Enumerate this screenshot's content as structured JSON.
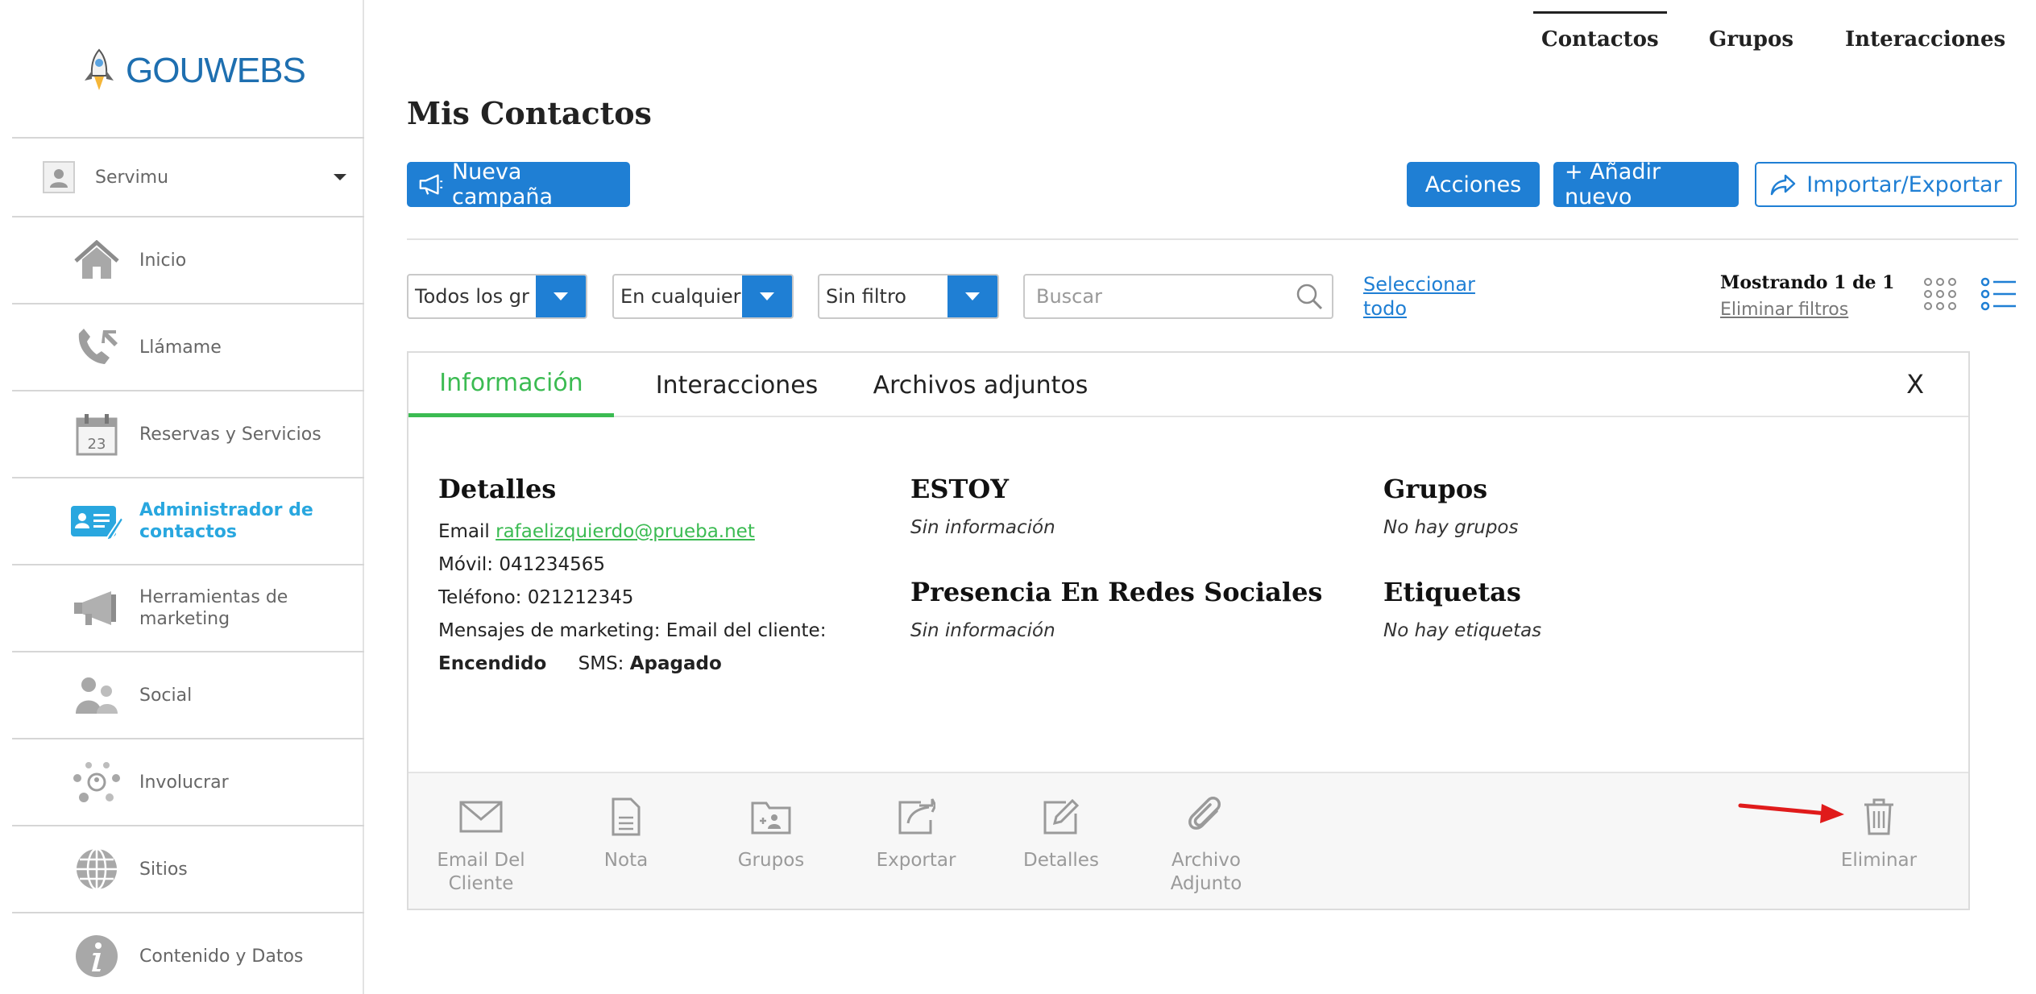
{
  "brand": {
    "logo_text": "GOUWEBS"
  },
  "account": {
    "name": "Servimu"
  },
  "sidebar": {
    "items": [
      {
        "label": "Inicio",
        "icon": "home-icon"
      },
      {
        "label": "Llámame",
        "icon": "phone-icon"
      },
      {
        "label": "Reservas y Servicios",
        "icon": "calendar-icon"
      },
      {
        "label": "Administrador de contactos",
        "icon": "contact-card-icon",
        "active": true
      },
      {
        "label": "Herramientas de marketing",
        "icon": "megaphone-icon"
      },
      {
        "label": "Social",
        "icon": "people-icon"
      },
      {
        "label": "Involucrar",
        "icon": "network-icon"
      },
      {
        "label": "Sitios",
        "icon": "globe-icon"
      },
      {
        "label": "Contenido y Datos",
        "icon": "info-icon"
      }
    ]
  },
  "top_nav": {
    "tabs": [
      "Contactos",
      "Grupos",
      "Interacciones"
    ],
    "active": "Contactos"
  },
  "page": {
    "title": "Mis Contactos"
  },
  "toolbar": {
    "new_campaign": "Nueva campaña",
    "actions": "Acciones",
    "add_new": "+ Añadir nuevo",
    "import_export": "Importar/Exportar"
  },
  "filters": {
    "group_select": "Todos los gr",
    "time_select": "En cualquier",
    "filter_select": "Sin filtro",
    "search_placeholder": "Buscar",
    "select_all_1": "Seleccionar",
    "select_all_2": "todo",
    "showing": "Mostrando 1 de 1",
    "clear_filters": "Eliminar filtros"
  },
  "panel": {
    "tabs": [
      "Información",
      "Interacciones",
      "Archivos adjuntos"
    ],
    "active_tab": "Información",
    "close": "X",
    "details": {
      "title": "Detalles",
      "email_label": "Email",
      "email": "rafaelizquierdo@prueba.net",
      "mobile": "Móvil: 041234565",
      "phone": "Teléfono: 021212345",
      "marketing": "Mensajes de marketing: Email del cliente:",
      "email_status": "Encendido",
      "sms_label": "SMS:",
      "sms_status": "Apagado"
    },
    "estoy": {
      "title": "ESTOY",
      "value": "Sin información"
    },
    "social": {
      "title": "Presencia En Redes Sociales",
      "value": "Sin información"
    },
    "groups": {
      "title": "Grupos",
      "value": "No hay grupos"
    },
    "tags": {
      "title": "Etiquetas",
      "value": "No hay etiquetas"
    },
    "actions": [
      {
        "label_1": "Email Del",
        "label_2": "Cliente",
        "icon": "envelope-icon"
      },
      {
        "label_1": "Nota",
        "label_2": "",
        "icon": "note-icon"
      },
      {
        "label_1": "Grupos",
        "label_2": "",
        "icon": "group-folder-icon"
      },
      {
        "label_1": "Exportar",
        "label_2": "",
        "icon": "export-icon"
      },
      {
        "label_1": "Detalles",
        "label_2": "",
        "icon": "edit-icon"
      },
      {
        "label_1": "Archivo",
        "label_2": "Adjunto",
        "icon": "paperclip-icon"
      }
    ],
    "delete": {
      "label": "Eliminar",
      "icon": "trash-icon"
    }
  },
  "colors": {
    "primary": "#1f7fd4",
    "active_green": "#3bbb52",
    "sidebar_active": "#29a7df",
    "annotation_arrow": "#e01b1b"
  }
}
